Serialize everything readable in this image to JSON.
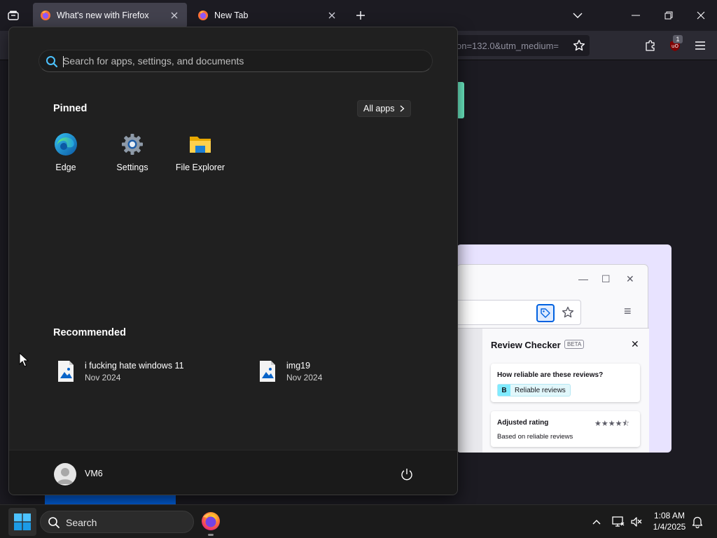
{
  "browser": {
    "tabs": [
      {
        "title": "What's new with Firefox",
        "active": true
      },
      {
        "title": "New Tab",
        "active": false
      }
    ],
    "url_fragment": "on=132.0&utm_medium=",
    "extension_badge": "1",
    "window_controls": [
      "minimize-icon",
      "restore-icon",
      "close-icon"
    ]
  },
  "page_content": {
    "review_checker": {
      "title": "Review Checker",
      "beta_label": "BETA",
      "question": "How reliable are these reviews?",
      "grade": "B",
      "grade_text": "Reliable reviews",
      "adjusted_rating_label": "Adjusted rating",
      "stars": "★★★★⯪",
      "based_on": "Based on reliable reviews"
    }
  },
  "start_menu": {
    "search_placeholder": "Search for apps, settings, and documents",
    "pinned_heading": "Pinned",
    "all_apps_label": "All apps",
    "pinned": [
      {
        "label": "Edge",
        "icon": "edge-icon"
      },
      {
        "label": "Settings",
        "icon": "settings-gear-icon"
      },
      {
        "label": "File Explorer",
        "icon": "folder-icon"
      }
    ],
    "recommended_heading": "Recommended",
    "recommended": [
      {
        "name": "i fucking hate windows 11",
        "date": "Nov 2024",
        "icon": "image-file-icon"
      },
      {
        "name": "img19",
        "date": "Nov 2024",
        "icon": "image-file-icon"
      }
    ],
    "user": {
      "name": "VM6"
    }
  },
  "taskbar": {
    "search_label": "Search",
    "time": "1:08 AM",
    "date": "1/4/2025"
  },
  "colors": {
    "accent_blue": "#0078d4",
    "firefox_dark": "#1c1b22",
    "start_bg": "#202020"
  }
}
